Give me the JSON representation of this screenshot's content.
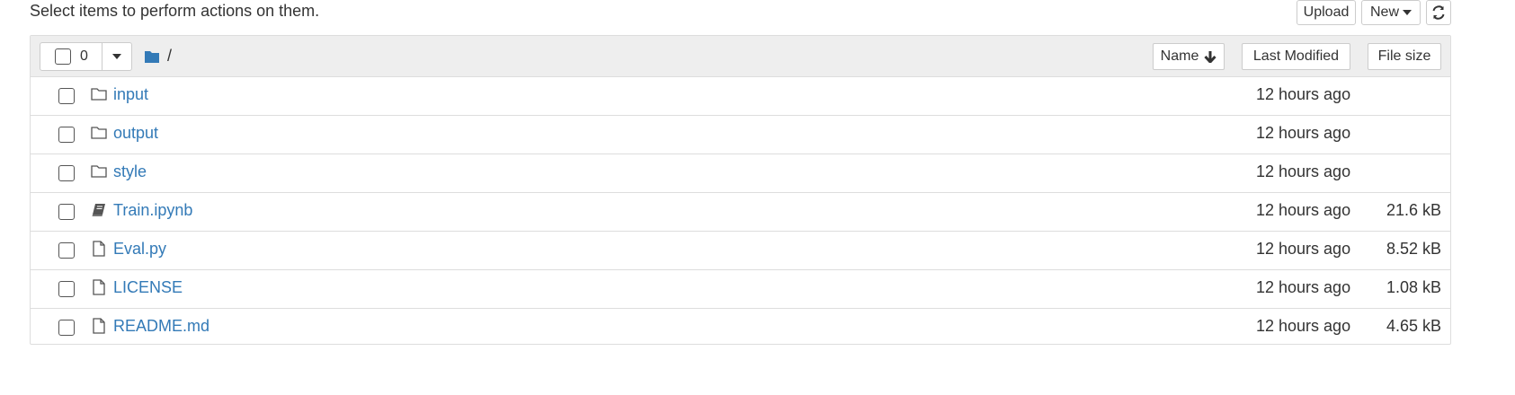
{
  "hint": "Select items to perform actions on them.",
  "toolbar": {
    "upload_label": "Upload",
    "new_label": "New",
    "refresh_icon": "refresh-icon"
  },
  "list": {
    "selected_count": "0",
    "breadcrumb_path": "/",
    "columns": {
      "name": "Name",
      "last_modified": "Last Modified",
      "file_size": "File size"
    },
    "items": [
      {
        "name": "input",
        "type": "folder",
        "modified": "12 hours ago",
        "size": ""
      },
      {
        "name": "output",
        "type": "folder",
        "modified": "12 hours ago",
        "size": ""
      },
      {
        "name": "style",
        "type": "folder",
        "modified": "12 hours ago",
        "size": ""
      },
      {
        "name": "Train.ipynb",
        "type": "notebook",
        "modified": "12 hours ago",
        "size": "21.6 kB"
      },
      {
        "name": "Eval.py",
        "type": "file",
        "modified": "12 hours ago",
        "size": "8.52 kB"
      },
      {
        "name": "LICENSE",
        "type": "file",
        "modified": "12 hours ago",
        "size": "1.08 kB"
      },
      {
        "name": "README.md",
        "type": "file",
        "modified": "12 hours ago",
        "size": "4.65 kB"
      }
    ]
  },
  "colors": {
    "link": "#337ab7",
    "folder_icon": "#337ab7",
    "header_bg": "#eeeeee",
    "border": "#dddddd"
  }
}
